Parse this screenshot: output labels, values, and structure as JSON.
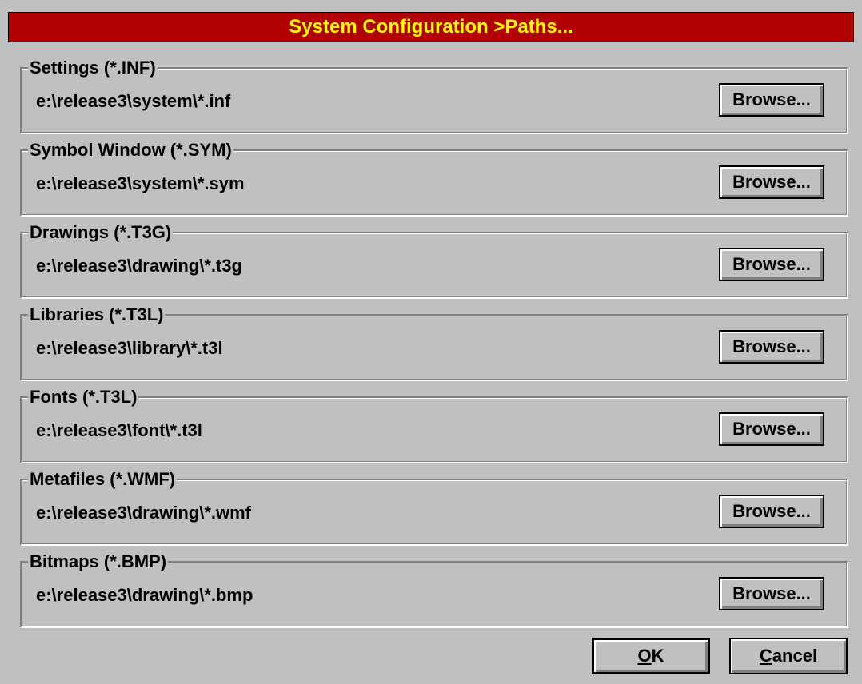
{
  "window": {
    "title": "System Configuration >Paths..."
  },
  "groups": [
    {
      "legend": "Settings (*.INF)",
      "path": "e:\\release3\\system\\*.inf",
      "button": "Browse..."
    },
    {
      "legend": "Symbol Window (*.SYM)",
      "path": "e:\\release3\\system\\*.sym",
      "button": "Browse..."
    },
    {
      "legend": "Drawings (*.T3G)",
      "path": "e:\\release3\\drawing\\*.t3g",
      "button": "Browse..."
    },
    {
      "legend": "Libraries (*.T3L)",
      "path": "e:\\release3\\library\\*.t3l",
      "button": "Browse..."
    },
    {
      "legend": "Fonts (*.T3L)",
      "path": "e:\\release3\\font\\*.t3l",
      "button": "Browse..."
    },
    {
      "legend": "Metafiles (*.WMF)",
      "path": "e:\\release3\\drawing\\*.wmf",
      "button": "Browse..."
    },
    {
      "legend": "Bitmaps (*.BMP)",
      "path": "e:\\release3\\drawing\\*.bmp",
      "button": "Browse..."
    }
  ],
  "buttons": {
    "ok_mnemonic": "O",
    "ok_rest": "K",
    "cancel_mnemonic": "C",
    "cancel_rest": "ancel"
  },
  "colors": {
    "titlebar_bg": "#b00000",
    "title_text": "#ffff00",
    "dialog_bg": "#c0c0c0"
  }
}
